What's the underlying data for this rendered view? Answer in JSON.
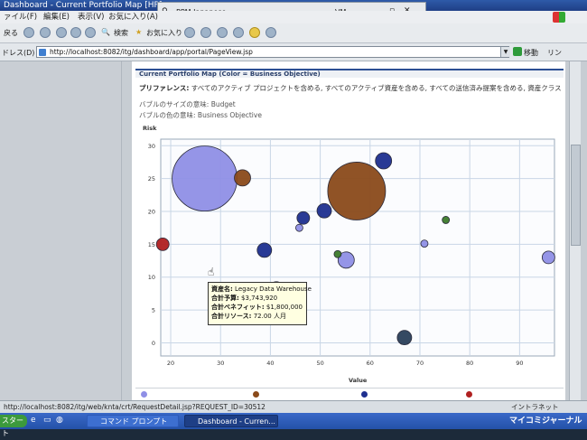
{
  "window": {
    "title": "Dashboard - Current Portfolio Map [HP]",
    "float_window_title": "PPM Japanese",
    "float_window_vm": "VM"
  },
  "menu": [
    "ァイル(F)",
    "編集(E)",
    "表示(V)",
    "お気に入り(A)"
  ],
  "toolbar": {
    "back_label": "戻る",
    "search_label": "検索",
    "favorites_label": "お気に入り"
  },
  "address": {
    "label": "ドレス(D)",
    "url": "http://localhost:8082/itg/dashboard/app/portal/PageView.jsp",
    "go_label": "移動",
    "links_label": "リン"
  },
  "portlet": {
    "title": "Current Portfolio Map (Color = Business Objective)",
    "prefs_label": "プリファレンス:",
    "prefs_text": "すべてのアクティブ プロジェクトを含める, すべてのアクティブ資産を含める, すべての送信済み提案を含める, 資産クラス - Informational",
    "size_meaning_label": "バブルのサイズの意味:",
    "size_meaning_value": "Budget",
    "color_meaning_label": "バブルの色の意味:",
    "color_meaning_value": "Business Objective"
  },
  "tooltip": {
    "name_key": "資産名:",
    "name_val": "Legacy Data Warehouse",
    "budget_key": "合計予算:",
    "budget_val": "$3,743,920",
    "benefit_key": "合計ベネフィット:",
    "benefit_val": "$1,800,000",
    "resource_key": "合計リソース:",
    "resource_val": "72.00 人月"
  },
  "chart_data": {
    "type": "scatter",
    "title": "",
    "xlabel": "Value",
    "ylabel": "Risk",
    "xlim": [
      18,
      97
    ],
    "ylim": [
      -2,
      31
    ],
    "xticks": [
      20,
      30,
      40,
      50,
      60,
      70,
      80,
      90
    ],
    "yticks": [
      0,
      5,
      10,
      15,
      20,
      25,
      30
    ],
    "grid": true,
    "points": [
      {
        "x": 26.8,
        "y": 25.0,
        "r": 36,
        "color": "#8f8fe6"
      },
      {
        "x": 57.3,
        "y": 23.1,
        "r": 32,
        "color": "#8a4a1a"
      },
      {
        "x": 34.4,
        "y": 25.1,
        "r": 9,
        "color": "#8a4a1a"
      },
      {
        "x": 62.7,
        "y": 27.7,
        "r": 9,
        "color": "#1e2f8f"
      },
      {
        "x": 50.8,
        "y": 20.1,
        "r": 8,
        "color": "#1e2f8f"
      },
      {
        "x": 46.6,
        "y": 19.0,
        "r": 7,
        "color": "#1e2f8f"
      },
      {
        "x": 45.8,
        "y": 17.5,
        "r": 4,
        "color": "#8f8fe6"
      },
      {
        "x": 38.8,
        "y": 14.1,
        "r": 8,
        "color": "#1e2f8f"
      },
      {
        "x": 18.4,
        "y": 15.0,
        "r": 7,
        "color": "#b02020"
      },
      {
        "x": 55.2,
        "y": 12.6,
        "r": 9,
        "color": "#8f8fe6"
      },
      {
        "x": 53.5,
        "y": 13.5,
        "r": 4,
        "color": "#3c7a2a"
      },
      {
        "x": 70.9,
        "y": 15.1,
        "r": 4,
        "color": "#8f8fe6"
      },
      {
        "x": 75.2,
        "y": 18.7,
        "r": 4,
        "color": "#3c7a2a"
      },
      {
        "x": 95.8,
        "y": 13.0,
        "r": 7,
        "color": "#8f8fe6"
      },
      {
        "x": 41.2,
        "y": 8.2,
        "r": 8,
        "color": "#8a4a1a"
      },
      {
        "x": 66.9,
        "y": 0.8,
        "r": 8,
        "color": "#2a3f5a"
      }
    ]
  },
  "status": {
    "url": "http://localhost:8082/itg/web/knta/crt/RequestDetail.jsp?REQUEST_ID=30512",
    "zone": "イントラネット"
  },
  "taskbar": {
    "start_label": "スタート",
    "task1": "コマンド プロンプト",
    "task2": "Dashboard - Curren...",
    "watermark": "マイコミジャーナル"
  }
}
